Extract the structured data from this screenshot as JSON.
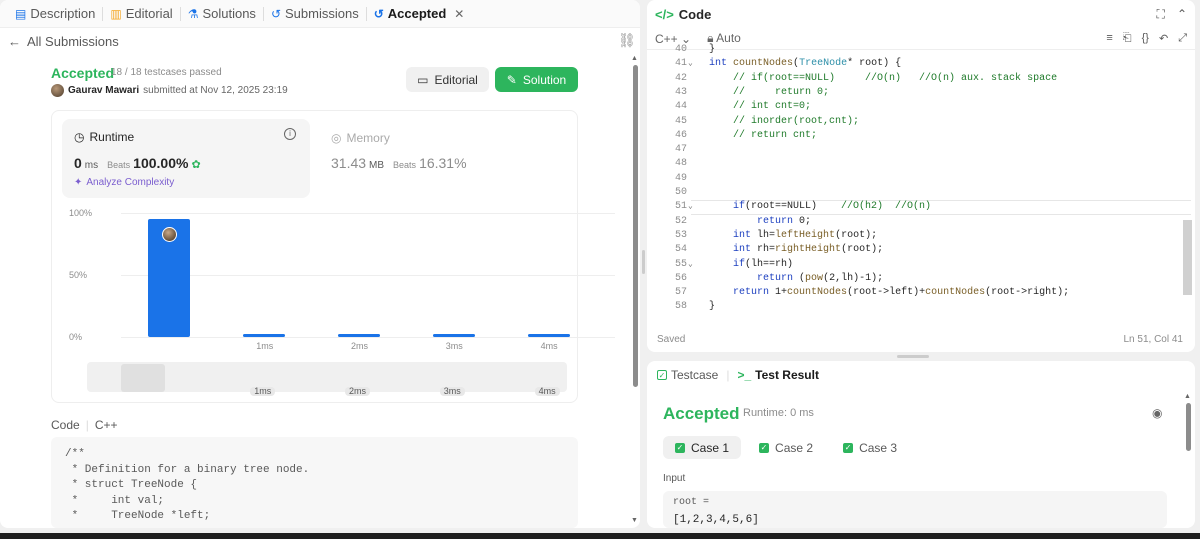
{
  "tabs": [
    {
      "label": "Description",
      "icon": "description-icon"
    },
    {
      "label": "Editorial",
      "icon": "book-icon"
    },
    {
      "label": "Solutions",
      "icon": "flask-icon"
    },
    {
      "label": "Submissions",
      "icon": "history-icon"
    },
    {
      "label": "Accepted",
      "icon": "history-icon"
    }
  ],
  "back_label": "All Submissions",
  "submission": {
    "status": "Accepted",
    "testcases": "18 / 18 testcases passed",
    "author": "Gaurav Mawari",
    "submitted": "submitted at Nov 12, 2025 23:19",
    "editorial_button": "Editorial",
    "solution_button": "Solution"
  },
  "runtime": {
    "label": "Runtime",
    "value": "0",
    "unit": "ms",
    "beats_label": "Beats",
    "beats": "100.00%",
    "analyze": "Analyze Complexity"
  },
  "memory": {
    "label": "Memory",
    "value": "31.43",
    "unit": "MB",
    "beats_label": "Beats",
    "beats": "16.31%"
  },
  "chart_data": {
    "type": "bar",
    "categories": [
      "0ms",
      "1ms",
      "2ms",
      "3ms",
      "4ms"
    ],
    "values": [
      95,
      1.5,
      1.5,
      1.5,
      1.5
    ],
    "yticks": [
      "100%",
      "50%",
      "0%"
    ],
    "xtick_labels": [
      "",
      "1ms",
      "2ms",
      "3ms",
      "4ms"
    ],
    "ylim": [
      0,
      100
    ],
    "highlight_index": 0,
    "color": "#1a73e8"
  },
  "code_section": {
    "label": "Code",
    "lang": "C++"
  },
  "code_lines": [
    "/**",
    " * Definition for a binary tree node.",
    " * struct TreeNode {",
    " *     int val;",
    " *     TreeNode *left;"
  ],
  "code_panel": {
    "title": "Code",
    "language": "C++",
    "mode": "Auto",
    "status": "Saved",
    "cursor": "Ln 51, Col 41"
  },
  "editor_lines": [
    {
      "n": "40",
      "fold": "",
      "t": "}"
    },
    {
      "n": "41",
      "fold": "v",
      "t": "int countNodes(TreeNode* root) {"
    },
    {
      "n": "42",
      "fold": "",
      "t": "    // if(root==NULL)     //O(n)   //O(n) aux. stack space"
    },
    {
      "n": "43",
      "fold": "",
      "t": "    //     return 0;"
    },
    {
      "n": "44",
      "fold": "",
      "t": "    // int cnt=0;"
    },
    {
      "n": "45",
      "fold": "",
      "t": "    // inorder(root,cnt);"
    },
    {
      "n": "46",
      "fold": "",
      "t": "    // return cnt;"
    },
    {
      "n": "47",
      "fold": "",
      "t": ""
    },
    {
      "n": "48",
      "fold": "",
      "t": ""
    },
    {
      "n": "49",
      "fold": "",
      "t": ""
    },
    {
      "n": "50",
      "fold": "",
      "t": ""
    },
    {
      "n": "51",
      "fold": "v",
      "t": "    if(root==NULL)    //O(h2)  //O(n)"
    },
    {
      "n": "52",
      "fold": "",
      "t": "        return 0;"
    },
    {
      "n": "53",
      "fold": "",
      "t": "    int lh=leftHeight(root);"
    },
    {
      "n": "54",
      "fold": "",
      "t": "    int rh=rightHeight(root);"
    },
    {
      "n": "55",
      "fold": "v",
      "t": "    if(lh==rh)"
    },
    {
      "n": "56",
      "fold": "",
      "t": "        return (pow(2,lh)-1);"
    },
    {
      "n": "57",
      "fold": "",
      "t": "    return 1+countNodes(root->left)+countNodes(root->right);"
    },
    {
      "n": "58",
      "fold": "",
      "t": "}"
    }
  ],
  "result_panel": {
    "testcase_tab": "Testcase",
    "result_tab": "Test Result",
    "status": "Accepted",
    "runtime": "Runtime: 0 ms",
    "cases": [
      "Case 1",
      "Case 2",
      "Case 3"
    ],
    "input_label": "Input",
    "var": "root =",
    "value": "[1,2,3,4,5,6]"
  }
}
